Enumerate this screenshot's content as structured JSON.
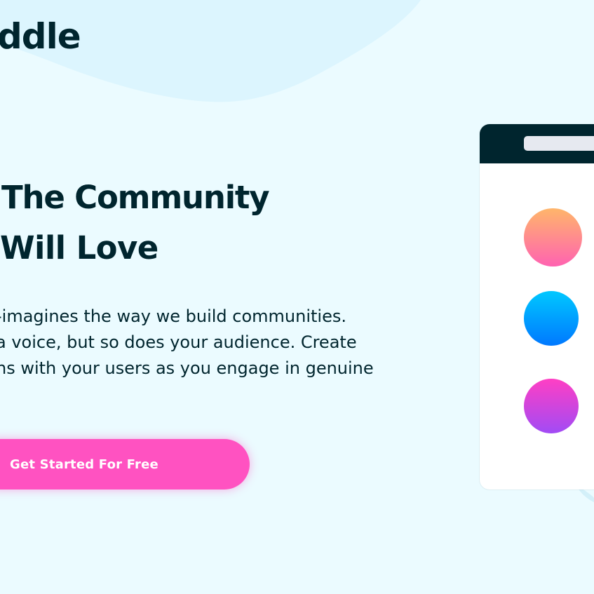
{
  "brand": {
    "logo_text": "ddle"
  },
  "hero": {
    "headline_line1": "The Community",
    "headline_line2": "Will Love",
    "description_lines": [
      "-imagines the way we build communities.",
      "a voice, but so does your audience. Create",
      "ns with your users as you engage in genuine",
      "."
    ],
    "cta_label": "Get Started For Free"
  },
  "colors": {
    "background": "#ebfbff",
    "background_blob": "#dcf5fe",
    "text_primary": "#00252e",
    "accent_pink": "#ff52c1",
    "phone_header": "#00252e",
    "phone_body": "#ffffff"
  },
  "mockup": {
    "avatars": [
      "orange-pink-gradient",
      "blue-gradient",
      "pink-purple-gradient"
    ]
  }
}
